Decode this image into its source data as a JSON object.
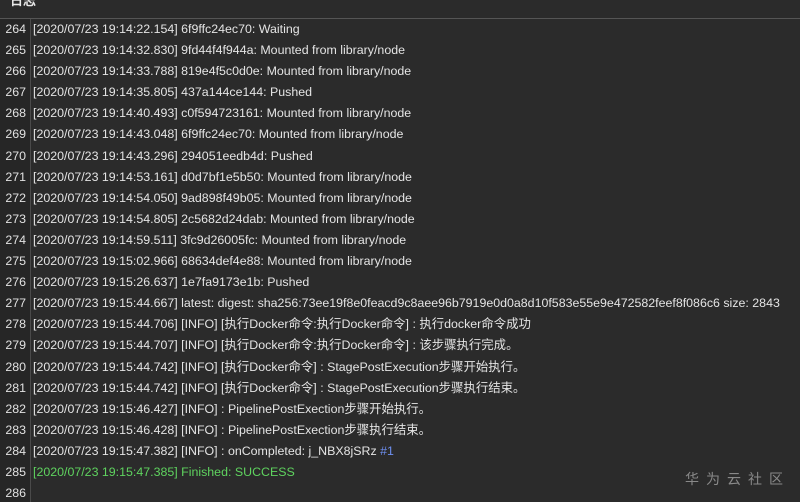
{
  "header": {
    "title": "日志"
  },
  "log": {
    "lines": [
      {
        "num": "264",
        "text": "[2020/07/23 19:14:22.154] 6f9ffc24ec70: Waiting",
        "status": "normal",
        "link": ""
      },
      {
        "num": "265",
        "text": "[2020/07/23 19:14:32.830] 9fd44f4f944a: Mounted from library/node",
        "status": "normal",
        "link": ""
      },
      {
        "num": "266",
        "text": "[2020/07/23 19:14:33.788] 819e4f5c0d0e: Mounted from library/node",
        "status": "normal",
        "link": ""
      },
      {
        "num": "267",
        "text": "[2020/07/23 19:14:35.805] 437a144ce144: Pushed",
        "status": "normal",
        "link": ""
      },
      {
        "num": "268",
        "text": "[2020/07/23 19:14:40.493] c0f594723161: Mounted from library/node",
        "status": "normal",
        "link": ""
      },
      {
        "num": "269",
        "text": "[2020/07/23 19:14:43.048] 6f9ffc24ec70: Mounted from library/node",
        "status": "normal",
        "link": ""
      },
      {
        "num": "270",
        "text": "[2020/07/23 19:14:43.296] 294051eedb4d: Pushed",
        "status": "normal",
        "link": ""
      },
      {
        "num": "271",
        "text": "[2020/07/23 19:14:53.161] d0d7bf1e5b50: Mounted from library/node",
        "status": "normal",
        "link": ""
      },
      {
        "num": "272",
        "text": "[2020/07/23 19:14:54.050] 9ad898f49b05: Mounted from library/node",
        "status": "normal",
        "link": ""
      },
      {
        "num": "273",
        "text": "[2020/07/23 19:14:54.805] 2c5682d24dab: Mounted from library/node",
        "status": "normal",
        "link": ""
      },
      {
        "num": "274",
        "text": "[2020/07/23 19:14:59.511] 3fc9d26005fc: Mounted from library/node",
        "status": "normal",
        "link": ""
      },
      {
        "num": "275",
        "text": "[2020/07/23 19:15:02.966] 68634def4e88: Mounted from library/node",
        "status": "normal",
        "link": ""
      },
      {
        "num": "276",
        "text": "[2020/07/23 19:15:26.637] 1e7fa9173e1b: Pushed",
        "status": "normal",
        "link": ""
      },
      {
        "num": "277",
        "text": "[2020/07/23 19:15:44.667] latest: digest: sha256:73ee19f8e0feacd9c8aee96b7919e0d0a8d10f583e55e9e472582feef8f086c6 size: 2843",
        "status": "normal",
        "link": ""
      },
      {
        "num": "278",
        "text": "[2020/07/23 19:15:44.706] [INFO] [执行Docker命令:执行Docker命令] : 执行docker命令成功",
        "status": "normal",
        "link": ""
      },
      {
        "num": "279",
        "text": "[2020/07/23 19:15:44.707] [INFO] [执行Docker命令:执行Docker命令] : 该步骤执行完成。",
        "status": "normal",
        "link": ""
      },
      {
        "num": "280",
        "text": "[2020/07/23 19:15:44.742] [INFO] [执行Docker命令] : StagePostExecution步骤开始执行。",
        "status": "normal",
        "link": ""
      },
      {
        "num": "281",
        "text": "[2020/07/23 19:15:44.742] [INFO] [执行Docker命令] : StagePostExecution步骤执行结束。",
        "status": "normal",
        "link": ""
      },
      {
        "num": "282",
        "text": "[2020/07/23 19:15:46.427] [INFO]  : PipelinePostExection步骤开始执行。",
        "status": "normal",
        "link": ""
      },
      {
        "num": "283",
        "text": "[2020/07/23 19:15:46.428] [INFO]  : PipelinePostExection步骤执行结束。",
        "status": "normal",
        "link": ""
      },
      {
        "num": "284",
        "text": "[2020/07/23 19:15:47.382] [INFO]  : onCompleted: j_NBX8jSRz ",
        "status": "normal",
        "link": "#1"
      },
      {
        "num": "285",
        "text": "[2020/07/23 19:15:47.385] Finished: SUCCESS",
        "status": "success",
        "link": ""
      },
      {
        "num": "286",
        "text": "",
        "status": "normal",
        "link": ""
      }
    ]
  },
  "watermark": "华为云社区",
  "colors": {
    "background": "#2b2b2b",
    "text": "#e4e4e4",
    "success": "#5fd35f",
    "link": "#6e8ff0"
  }
}
